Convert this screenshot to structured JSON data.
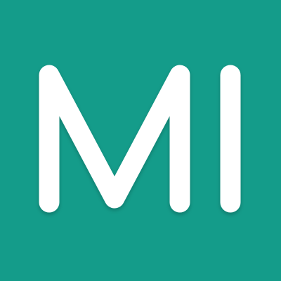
{
  "icon": {
    "monogram": "MI",
    "background_color": "#149c8a",
    "letter_color": "#ffffff"
  }
}
